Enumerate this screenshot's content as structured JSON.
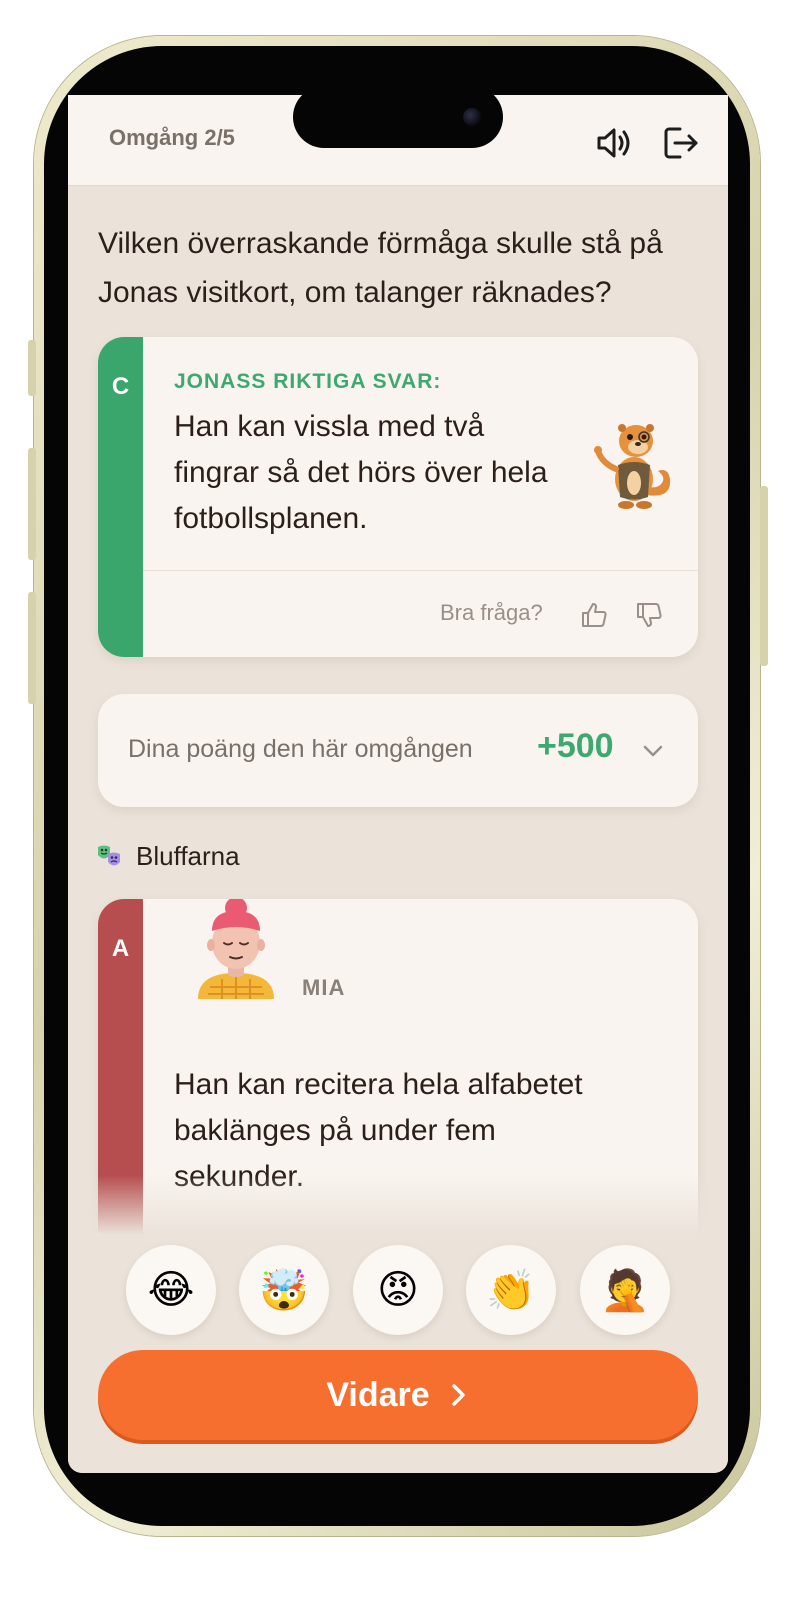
{
  "header": {
    "round_label": "Omgång 2/5",
    "sound_icon": "speaker-icon",
    "exit_icon": "logout-icon"
  },
  "question": {
    "text": "Vilken överraskande förmåga skulle stå på Jonas visitkort, om talanger räknades?"
  },
  "correct_answer": {
    "letter": "C",
    "kicker": "JONASS RIKTIGA SVAR:",
    "text": "Han kan vissla med två fingrar så det hörs över hela fotbollsplanen.",
    "mascot": "otter-mascot-icon",
    "feedback_label": "Bra fråga?",
    "accent_color": "#3aa66c"
  },
  "score": {
    "label": "Dina poäng den här omgången",
    "value": "+500",
    "color": "#3da86f"
  },
  "bluffs": {
    "section_title": "Bluffarna",
    "section_icon": "theater-masks-icon",
    "cards": [
      {
        "letter": "A",
        "player": "MIA",
        "avatar": "avatar-mia",
        "text": "Han kan recitera hela alfabetet baklänges på under fem sekunder.",
        "accent_color": "#b64e4f"
      }
    ]
  },
  "reactions": [
    {
      "emoji": "😂",
      "name": "laughing-tears-emoji"
    },
    {
      "emoji": "🤯",
      "name": "mind-blown-emoji"
    },
    {
      "emoji": "😡",
      "name": "angry-emoji"
    },
    {
      "emoji": "👏",
      "name": "clapping-emoji"
    },
    {
      "emoji": "🤦",
      "name": "facepalm-emoji"
    }
  ],
  "next_button": {
    "label": "Vidare"
  }
}
